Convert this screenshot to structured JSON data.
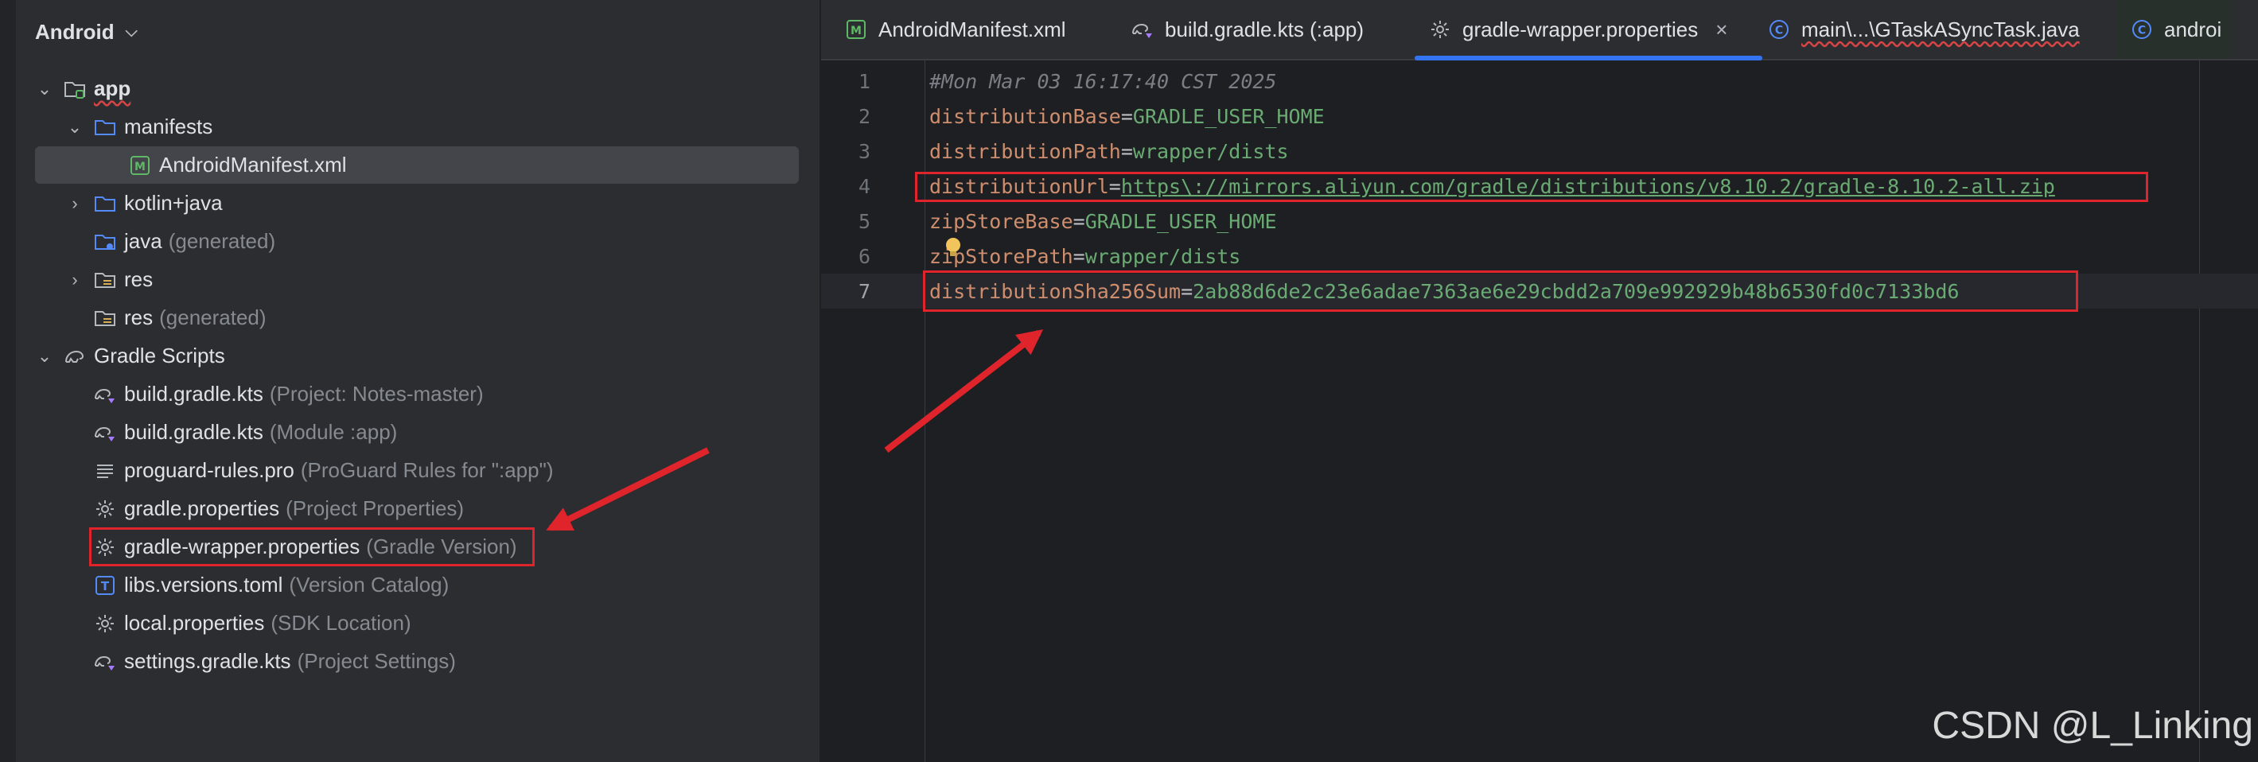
{
  "project_panel": {
    "view_selector": "Android",
    "tree": [
      {
        "label": "app",
        "hint": "",
        "icon": "module-folder-icon"
      },
      {
        "label": "manifests",
        "hint": "",
        "icon": "folder-icon"
      },
      {
        "label": "AndroidManifest.xml",
        "hint": "",
        "icon": "manifest-file-icon"
      },
      {
        "label": "kotlin+java",
        "hint": "",
        "icon": "folder-icon"
      },
      {
        "label": "java",
        "hint": "(generated)",
        "icon": "generated-folder-icon"
      },
      {
        "label": "res",
        "hint": "",
        "icon": "resource-folder-icon"
      },
      {
        "label": "res",
        "hint": "(generated)",
        "icon": "resource-folder-icon"
      },
      {
        "label": "Gradle Scripts",
        "hint": "",
        "icon": "gradle-icon"
      },
      {
        "label": "build.gradle.kts",
        "hint": "(Project: Notes-master)",
        "icon": "gradle-kts-icon"
      },
      {
        "label": "build.gradle.kts",
        "hint": "(Module :app)",
        "icon": "gradle-kts-icon"
      },
      {
        "label": "proguard-rules.pro",
        "hint": "(ProGuard Rules for \":app\")",
        "icon": "text-lines-icon"
      },
      {
        "label": "gradle.properties",
        "hint": "(Project Properties)",
        "icon": "gear-icon"
      },
      {
        "label": "gradle-wrapper.properties",
        "hint": "(Gradle Version)",
        "icon": "gear-icon"
      },
      {
        "label": "libs.versions.toml",
        "hint": "(Version Catalog)",
        "icon": "toml-icon"
      },
      {
        "label": "local.properties",
        "hint": "(SDK Location)",
        "icon": "gear-icon"
      },
      {
        "label": "settings.gradle.kts",
        "hint": "(Project Settings)",
        "icon": "gradle-kts-icon"
      }
    ]
  },
  "tabs": [
    {
      "label": "AndroidManifest.xml",
      "icon": "manifest-file-icon"
    },
    {
      "label": "build.gradle.kts (:app)",
      "icon": "gradle-kts-icon"
    },
    {
      "label": "gradle-wrapper.properties",
      "icon": "gear-icon"
    },
    {
      "label": "main\\...\\GTaskASyncTask.java",
      "icon": "class-icon"
    },
    {
      "label": "androi",
      "icon": "class-icon"
    }
  ],
  "active_tab_close": "×",
  "editor": {
    "lines": [
      {
        "num": "1",
        "comment": "#Mon Mar 03 16:17:40 CST 2025"
      },
      {
        "num": "2",
        "key": "distributionBase",
        "value": "GRADLE_USER_HOME"
      },
      {
        "num": "3",
        "key": "distributionPath",
        "value": "wrapper/dists"
      },
      {
        "num": "4",
        "key": "distributionUrl",
        "value": "https\\://mirrors.aliyun.com/gradle/distributions/v8.10.2/gradle-8.10.2-all.zip"
      },
      {
        "num": "5",
        "key": "zipStoreBase",
        "value": "GRADLE_USER_HOME"
      },
      {
        "num": "6",
        "key": "zipStorePath",
        "value": "wrapper/dists"
      },
      {
        "num": "7",
        "key": "distributionSha256Sum",
        "value": "2ab88d6de2c23e6adae7363ae6e29cbdd2a709e992929b48b6530fd0c7133bd6"
      }
    ],
    "equals": "="
  },
  "watermark": "CSDN @L_Linking",
  "colors": {
    "annotation": "#e0242b",
    "accent": "#3574f0"
  }
}
